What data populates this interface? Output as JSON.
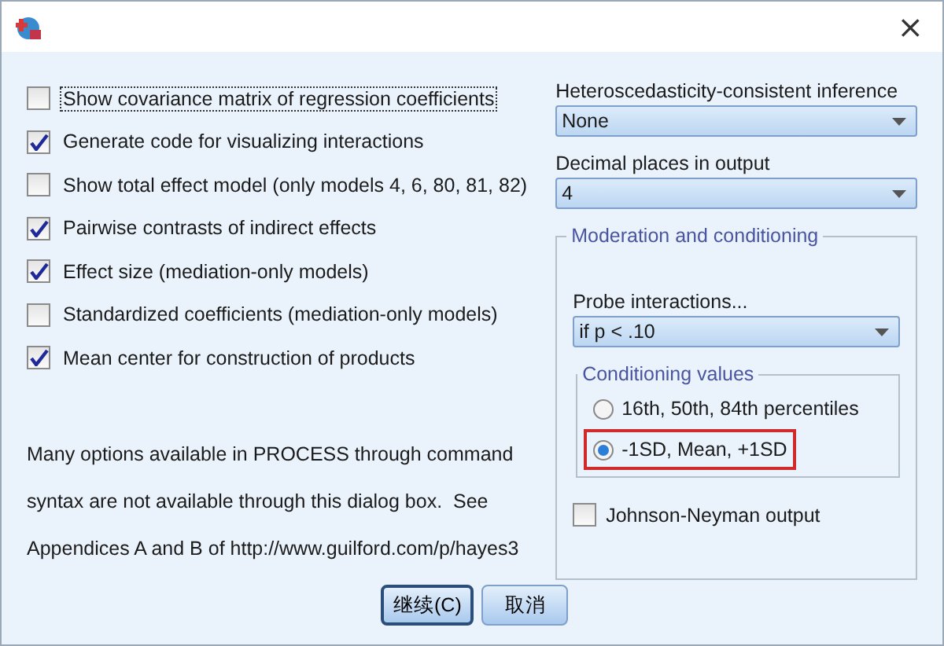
{
  "window": {
    "close": "×"
  },
  "options": [
    {
      "label": "Show covariance matrix of regression coefficients",
      "checked": false,
      "focused": true
    },
    {
      "label": "Generate code for visualizing interactions",
      "checked": true,
      "focused": false
    },
    {
      "label": "Show total effect model (only models 4, 6, 80, 81, 82)",
      "checked": false,
      "focused": false
    },
    {
      "label": "Pairwise contrasts of indirect effects",
      "checked": true,
      "focused": false
    },
    {
      "label": "Effect size (mediation-only models)",
      "checked": true,
      "focused": false
    },
    {
      "label": "Standardized coefficients (mediation-only models)",
      "checked": false,
      "focused": false
    },
    {
      "label": "Mean center for construction of products",
      "checked": true,
      "focused": false
    }
  ],
  "note": [
    "Many options available in PROCESS through command",
    "syntax are not available through this dialog box.  See",
    "Appendices A and B of http://www.guilford.com/p/hayes3"
  ],
  "hc_inference": {
    "label": "Heteroscedasticity-consistent inference",
    "value": "None"
  },
  "decimals": {
    "label": "Decimal places in output",
    "value": "4"
  },
  "moderation": {
    "title": "Moderation and conditioning",
    "probe": {
      "label": "Probe interactions...",
      "value": "if p < .10"
    },
    "conditioning": {
      "title": "Conditioning values",
      "options": [
        {
          "label": "16th, 50th, 84th percentiles",
          "selected": false,
          "highlighted": false
        },
        {
          "label": "-1SD, Mean, +1SD",
          "selected": true,
          "highlighted": true
        }
      ]
    },
    "johnson_neyman": {
      "label": "Johnson-Neyman output",
      "checked": false
    }
  },
  "buttons": [
    {
      "label": "继续(C)",
      "default": true
    },
    {
      "label": "取消",
      "default": false
    }
  ]
}
